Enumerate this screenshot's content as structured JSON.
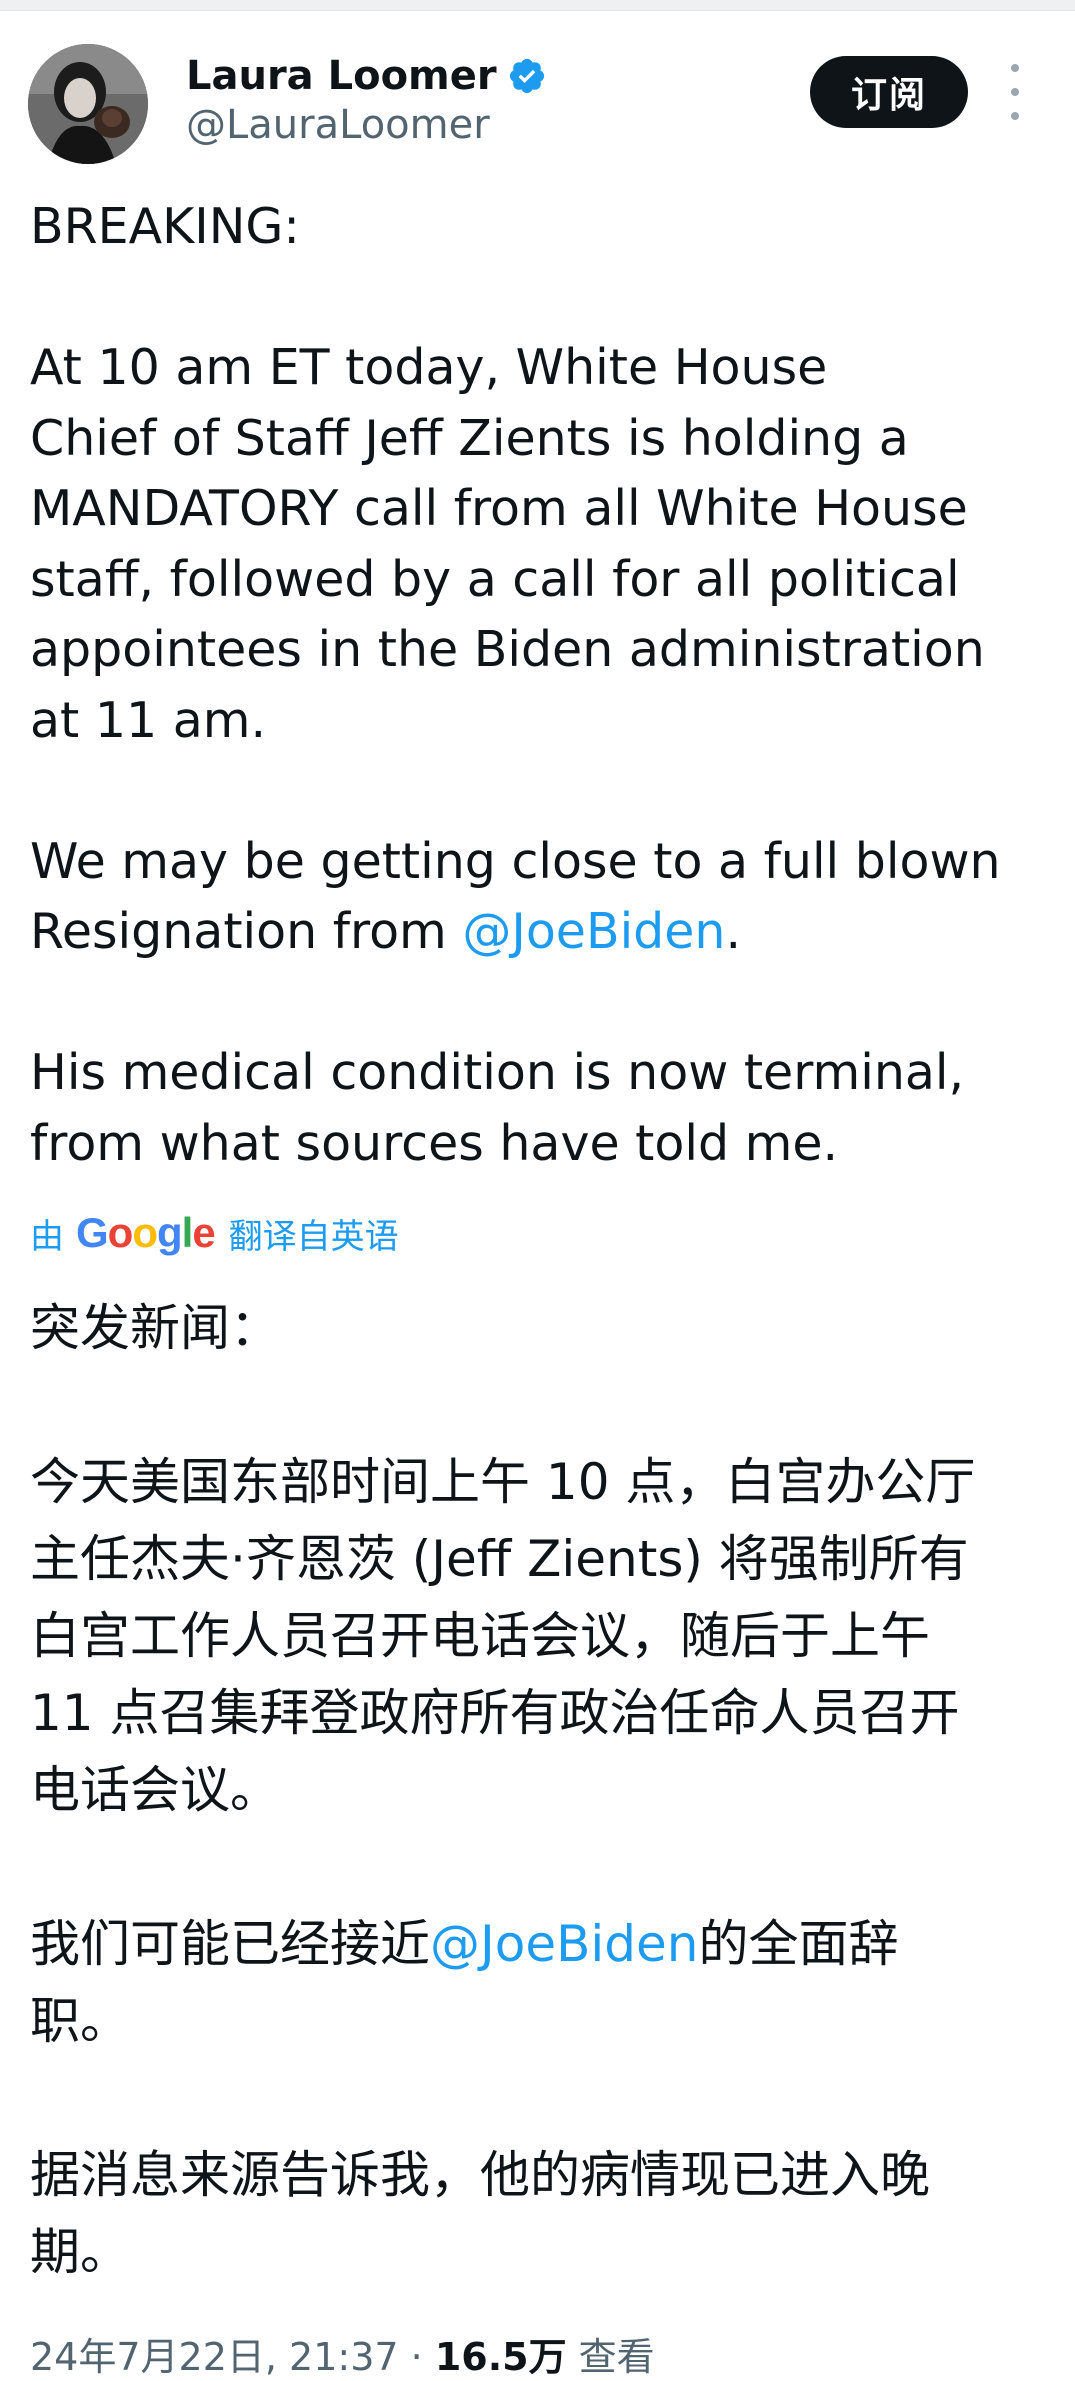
{
  "author": {
    "display_name": "Laura Loomer",
    "handle": "@LauraLoomer",
    "verified_icon": "verified-badge-icon",
    "avatar_icon": "profile-photo"
  },
  "header": {
    "subscribe_label": "订阅",
    "more_icon": "more-dots-icon"
  },
  "tweet": {
    "lines": [
      "BREAKING:",
      "",
      "At 10 am ET today, White House",
      "Chief of Staff Jeff Zients is holding a",
      "MANDATORY call from all White House",
      "staff, followed by a call for all political",
      "appointees in the Biden administration",
      "at 11 am.",
      "",
      "We may be getting close to a full blown",
      "",
      "",
      "His medical condition is now terminal,",
      "from what sources have told me."
    ],
    "resignation_prefix": "Resignation from ",
    "mention": "@JoeBiden",
    "resignation_suffix": "."
  },
  "translation": {
    "prefix": "由",
    "google": "Google",
    "suffix": "翻译自英语",
    "lines": [
      "突发新闻：",
      "",
      "今天美国东部时间上午 10 点，白宫办公厅",
      "主任杰夫·齐恩茨 (Jeff Zients) 将强制所有",
      "白宫工作人员召开电话会议，随后于上午",
      "11 点召集拜登政府所有政治任命人员召开",
      "电话会议。",
      "",
      "",
      "职。",
      "",
      "据消息来源告诉我，他的病情现已进入晚",
      "期。"
    ],
    "zh_mention_prefix": "我们可能已经接近",
    "zh_mention": "@JoeBiden",
    "zh_mention_suffix": "的全面辞"
  },
  "meta": {
    "timestamp": "24年7月22日, 21:37",
    "separator": " · ",
    "views_count": "16.5万",
    "views_label": " 查看"
  },
  "colors": {
    "accent": "#1d9bf0",
    "text": "#0f1419",
    "secondary": "#536471"
  }
}
